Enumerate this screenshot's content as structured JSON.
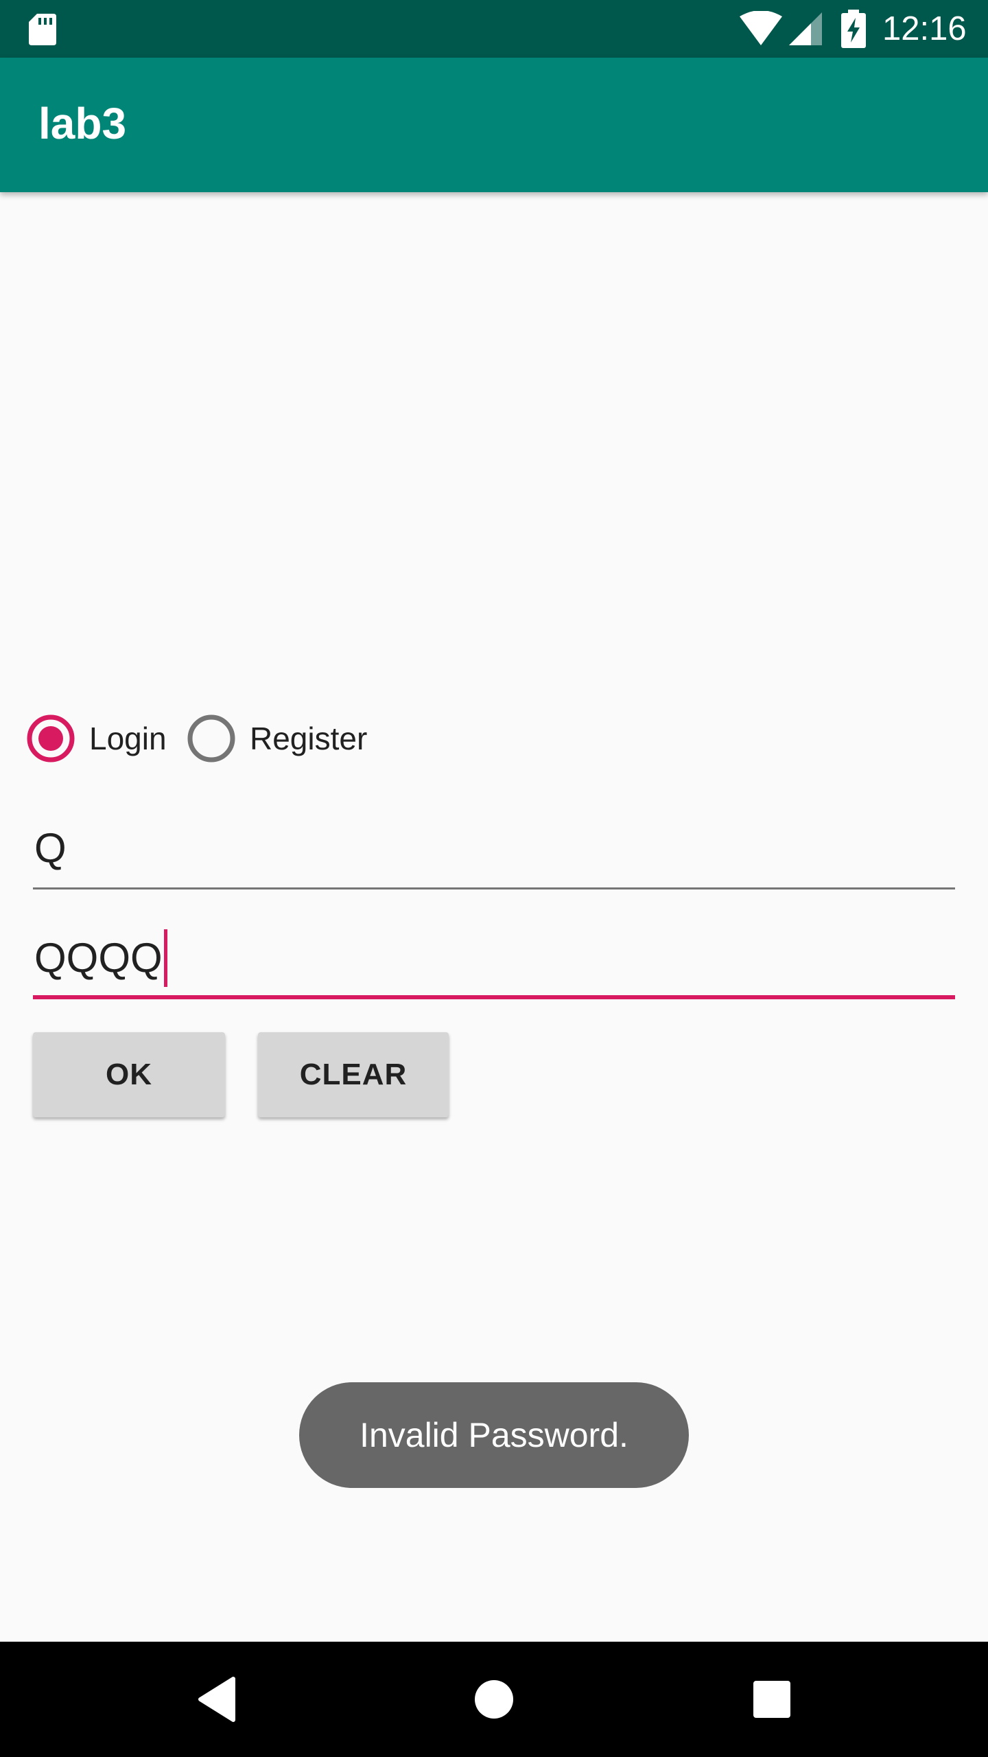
{
  "status_bar": {
    "time": "12:16",
    "icons": [
      "sd-card-icon",
      "wifi-icon",
      "cell-signal-icon",
      "battery-charging-icon"
    ]
  },
  "app_bar": {
    "title": "lab3"
  },
  "mode_radio": {
    "options": [
      {
        "label": "Login",
        "checked": true
      },
      {
        "label": "Register",
        "checked": false
      }
    ]
  },
  "form": {
    "username_value": "Q",
    "password_value": "QQQQ"
  },
  "buttons": {
    "ok_label": "OK",
    "clear_label": "CLEAR"
  },
  "toast": {
    "message": "Invalid Password."
  },
  "nav_bar": {
    "icons": [
      "back-icon",
      "home-icon",
      "recents-icon"
    ]
  },
  "colors": {
    "status_bar": "#00574b",
    "app_bar": "#008577",
    "accent": "#d81b60",
    "background": "#fafafa",
    "button": "#d6d6d6",
    "toast": "#676767"
  }
}
